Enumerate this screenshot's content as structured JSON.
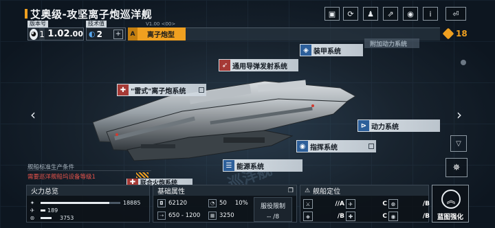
{
  "header": {
    "title": "艾奥级-攻坚离子炮巡洋舰",
    "toolbar": [
      {
        "name": "image-icon",
        "glyph": "▣"
      },
      {
        "name": "refresh-icon",
        "glyph": "⟳"
      },
      {
        "name": "person-icon",
        "glyph": "♟"
      },
      {
        "name": "share-icon",
        "glyph": "⇗"
      },
      {
        "name": "eye-icon",
        "glyph": "◉"
      },
      {
        "name": "info-icon",
        "glyph": "i"
      },
      {
        "name": "back-icon",
        "glyph": "⏎"
      }
    ]
  },
  "version": {
    "label": "版本号",
    "major": "1",
    "minor": "1.02",
    "suffix": ".00",
    "small": "V1.00 <00>"
  },
  "tech": {
    "label": "技术值",
    "value": "2",
    "plus": "+"
  },
  "weapon_type": {
    "letter": "A",
    "label": "离子炮型"
  },
  "cost": "18",
  "systems": {
    "armor": "装甲系统",
    "extra": "附加动力系统",
    "missile": "通用导弹发射系统",
    "ion": "\"雷式\"离子炮系统",
    "power": "动力系统",
    "command": "指挥系统",
    "energy": "能源系统",
    "integrated": "联合火炮系统"
  },
  "nav": {
    "left": "‹",
    "right": "›"
  },
  "production": {
    "label": "舰船标准生产条件",
    "warning": "需要巡洋舰船坞设备等级1"
  },
  "firepower": {
    "title": "火力总览",
    "rows": [
      {
        "icon": "✦",
        "value": "18885",
        "fill": 0.86
      },
      {
        "icon": "✈",
        "value": "189",
        "fill": 0.06
      },
      {
        "icon": "⊛",
        "value": "3753",
        "fill": 0.14
      }
    ]
  },
  "attributes": {
    "title": "基础属性",
    "hp": "62120",
    "armor": "50",
    "armor_pct": "10%",
    "speed": "650 - 1200",
    "storage": "3250",
    "service_label": "服役限制",
    "service_value": "-- /8"
  },
  "positioning": {
    "title": "舰船定位",
    "cells": [
      {
        "grade": "//A"
      },
      {
        "grade": "C"
      },
      {
        "grade": "/B"
      },
      {
        "grade": "/B"
      },
      {
        "grade": "C"
      },
      {
        "grade": "/B"
      }
    ]
  },
  "enhance": {
    "label": "蓝图强化"
  },
  "watermark": "巡洋舰"
}
